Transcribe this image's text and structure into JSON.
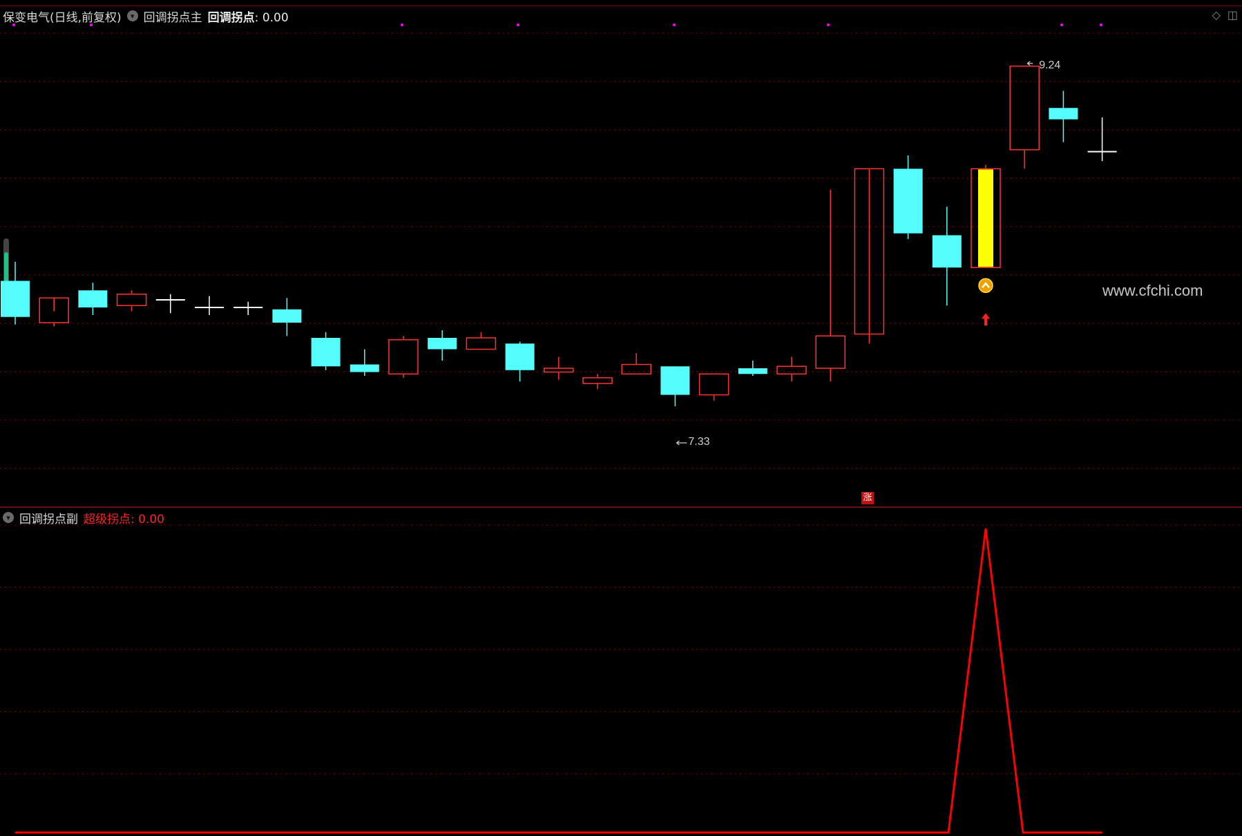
{
  "main": {
    "title": "保变电气(日线,前复权)",
    "indicator_name": "回调拐点主",
    "indicator_label": "回调拐点",
    "indicator_value": "0.00"
  },
  "sub": {
    "indicator_name": "回调拐点副",
    "value_label": "超级拐点",
    "value": "0.00"
  },
  "annotations": {
    "high_label": "9.24",
    "low_label": "7.33",
    "badge": "涨"
  },
  "watermark": "www.cfchi.com",
  "colors": {
    "background": "#000000",
    "up": "#ff3232",
    "down": "#54fcfc",
    "doji": "#ffffff",
    "signal_candle": "#ffff00",
    "line": "#ff0000",
    "grid": "#8b0000",
    "marker": "#ff00ff"
  },
  "chart_data": [
    {
      "type": "candlestick",
      "title": "保变电气(日线,前复权)",
      "ylim": [
        7.05,
        9.45
      ],
      "candles": [
        {
          "o": 8.11,
          "h": 8.21,
          "l": 7.88,
          "c": 7.92,
          "k": "down"
        },
        {
          "o": 7.89,
          "h": 7.95,
          "l": 7.87,
          "c": 8.02,
          "k": "up"
        },
        {
          "o": 8.06,
          "h": 8.1,
          "l": 7.93,
          "c": 7.97,
          "k": "down"
        },
        {
          "o": 7.98,
          "h": 8.06,
          "l": 7.95,
          "c": 8.04,
          "k": "up"
        },
        {
          "o": 8.01,
          "h": 8.04,
          "l": 7.94,
          "c": 8.01,
          "k": "doji"
        },
        {
          "o": 7.97,
          "h": 8.03,
          "l": 7.93,
          "c": 7.97,
          "k": "doji"
        },
        {
          "o": 7.97,
          "h": 8.0,
          "l": 7.93,
          "c": 7.97,
          "k": "doji"
        },
        {
          "o": 7.96,
          "h": 8.02,
          "l": 7.82,
          "c": 7.89,
          "k": "down"
        },
        {
          "o": 7.81,
          "h": 7.84,
          "l": 7.64,
          "c": 7.66,
          "k": "down"
        },
        {
          "o": 7.67,
          "h": 7.75,
          "l": 7.61,
          "c": 7.63,
          "k": "down"
        },
        {
          "o": 7.62,
          "h": 7.82,
          "l": 7.6,
          "c": 7.8,
          "k": "up"
        },
        {
          "o": 7.81,
          "h": 7.85,
          "l": 7.69,
          "c": 7.75,
          "k": "down"
        },
        {
          "o": 7.75,
          "h": 7.84,
          "l": 7.75,
          "c": 7.81,
          "k": "up"
        },
        {
          "o": 7.78,
          "h": 7.79,
          "l": 7.58,
          "c": 7.64,
          "k": "down"
        },
        {
          "o": 7.63,
          "h": 7.71,
          "l": 7.59,
          "c": 7.65,
          "k": "up"
        },
        {
          "o": 7.57,
          "h": 7.62,
          "l": 7.54,
          "c": 7.6,
          "k": "up"
        },
        {
          "o": 7.62,
          "h": 7.73,
          "l": 7.62,
          "c": 7.67,
          "k": "up"
        },
        {
          "o": 7.66,
          "h": 7.66,
          "l": 7.45,
          "c": 7.51,
          "k": "down"
        },
        {
          "o": 7.51,
          "h": 7.62,
          "l": 7.48,
          "c": 7.62,
          "k": "up"
        },
        {
          "o": 7.65,
          "h": 7.69,
          "l": 7.61,
          "c": 7.62,
          "k": "down"
        },
        {
          "o": 7.62,
          "h": 7.71,
          "l": 7.58,
          "c": 7.66,
          "k": "up"
        },
        {
          "o": 7.65,
          "h": 8.59,
          "l": 7.58,
          "c": 7.82,
          "k": "up"
        },
        {
          "o": 7.83,
          "h": 7.83,
          "l": 7.78,
          "c": 8.7,
          "k": "up"
        },
        {
          "o": 8.7,
          "h": 8.77,
          "l": 8.33,
          "c": 8.36,
          "k": "down"
        },
        {
          "o": 8.35,
          "h": 8.5,
          "l": 7.98,
          "c": 8.18,
          "k": "down"
        },
        {
          "o": 8.7,
          "h": 8.72,
          "l": 8.18,
          "c": 8.18,
          "k": "signal"
        },
        {
          "o": 8.8,
          "h": 9.24,
          "l": 8.7,
          "c": 9.24,
          "k": "up"
        },
        {
          "o": 9.02,
          "h": 9.11,
          "l": 8.84,
          "c": 8.96,
          "k": "down"
        },
        {
          "o": 8.79,
          "h": 8.97,
          "l": 8.74,
          "c": 8.79,
          "k": "doji"
        }
      ],
      "annotations": [
        {
          "text": "9.24",
          "index": 26,
          "price": 9.24
        },
        {
          "text": "7.33",
          "index": 17,
          "price": 7.33
        }
      ]
    },
    {
      "type": "line",
      "series": [
        {
          "name": "超级拐点",
          "values": [
            0,
            0,
            0,
            0,
            0,
            0,
            0,
            0,
            0,
            0,
            0,
            0,
            0,
            0,
            0,
            0,
            0,
            0,
            0,
            0,
            0,
            0,
            0,
            0,
            0,
            100,
            0,
            0,
            0
          ]
        }
      ],
      "ylim": [
        0,
        100
      ]
    }
  ]
}
